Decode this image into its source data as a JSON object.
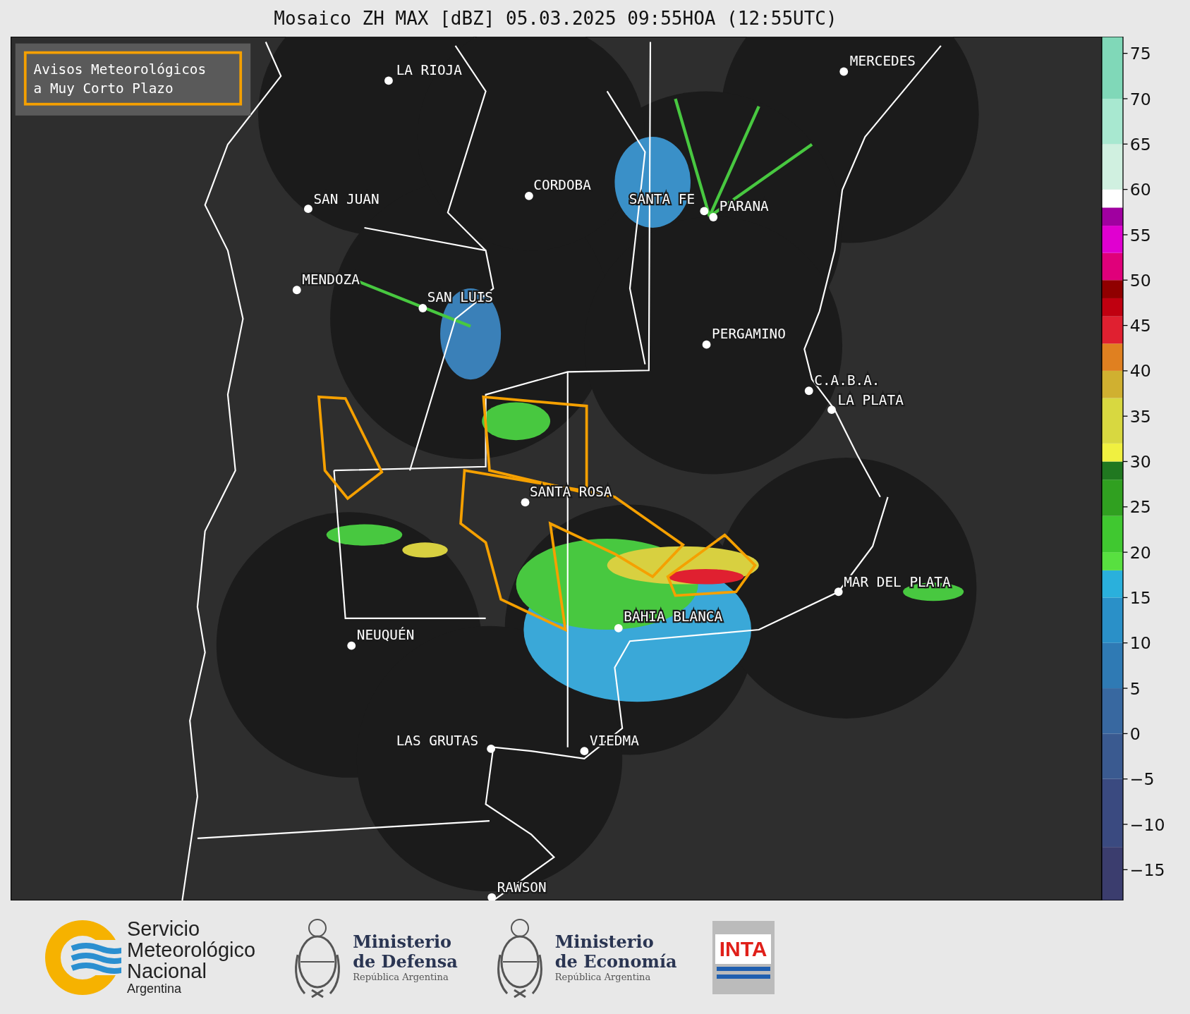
{
  "title": "Mosaico ZH MAX [dBZ] 05.03.2025 09:55HOA (12:55UTC)",
  "legend": {
    "lines": [
      "Avisos Meteorológicos",
      "a Muy Corto Plazo"
    ]
  },
  "cities": [
    "LA RIOJA",
    "MERCEDES",
    "CORDOBA",
    "SAN JUAN",
    "SANTA FE",
    "PARANA",
    "MENDOZA",
    "SAN LUIS",
    "PERGAMINO",
    "C.A.B.A.",
    "LA PLATA",
    "SANTA ROSA",
    "MAR DEL PLATA",
    "BAHIA BLANCA",
    "NEUQUÉN",
    "LAS GRUTAS",
    "VIEDMA",
    "RAWSON"
  ],
  "colorbar": {
    "ticks": [
      "75",
      "70",
      "65",
      "60",
      "55",
      "50",
      "45",
      "40",
      "35",
      "30",
      "25",
      "20",
      "15",
      "10",
      "5",
      "0",
      "−5",
      "−10",
      "−15"
    ]
  },
  "logos": [
    {
      "kind": "smn",
      "lines": [
        "Servicio",
        "Meteorológico",
        "Nacional"
      ],
      "sub": "Argentina"
    },
    {
      "kind": "ministry",
      "lines": [
        "Ministerio",
        "de Defensa"
      ],
      "sub": "República Argentina"
    },
    {
      "kind": "ministry",
      "lines": [
        "Ministerio",
        "de Economía"
      ],
      "sub": "República Argentina"
    },
    {
      "kind": "inta",
      "lines": [
        "INTA"
      ]
    }
  ]
}
